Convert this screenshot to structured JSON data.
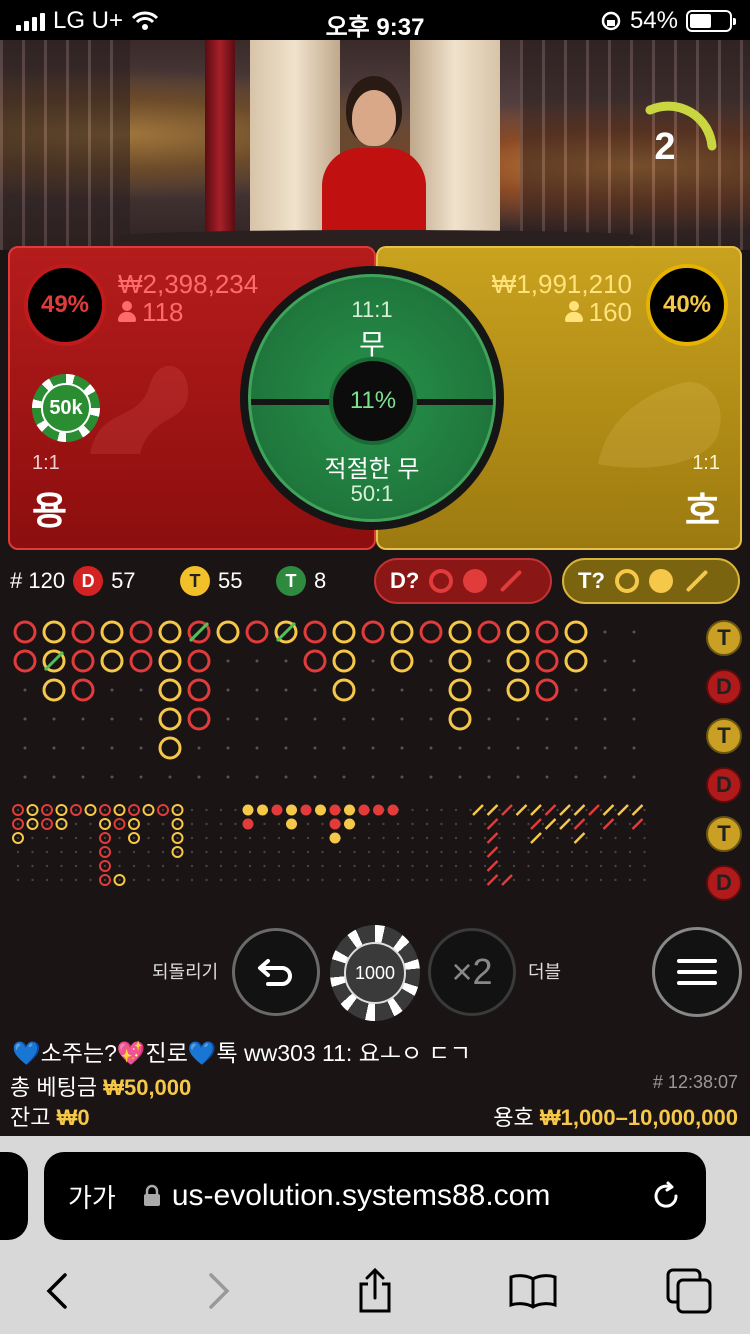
{
  "status_bar": {
    "carrier": "LG U+",
    "time": "오후 9:37",
    "battery": "54%",
    "battery_level": 0.54
  },
  "video": {
    "countdown": "2"
  },
  "dragon": {
    "percent": "49%",
    "amount": "₩2,398,234",
    "players": "118",
    "odds": "1:1",
    "name": "용"
  },
  "tiger": {
    "percent": "40%",
    "amount": "₩1,991,210",
    "players": "160",
    "odds": "1:1",
    "name": "호"
  },
  "tie": {
    "odds": "11:1",
    "name": "무",
    "percent": "11%",
    "suited_name": "적절한 무",
    "suited_odds": "50:1"
  },
  "chip_selected": "50k",
  "stats": {
    "round": "# 120",
    "dragon_badge": "D",
    "dragon": "57",
    "tiger_badge": "T",
    "tiger": "55",
    "tie_badge": "T",
    "tie": "8"
  },
  "predict": {
    "dragon": "D?",
    "tiger": "T?"
  },
  "side_predictions": [
    "T",
    "D",
    "T",
    "D",
    "T",
    "D"
  ],
  "colors": {
    "dragon": "#d42121",
    "tiger": "#f2c029",
    "tie": "#2d8a3f"
  },
  "controls": {
    "undo_label": "되돌리기",
    "chip": "1000",
    "double_symbol": "×2",
    "double_label": "더블"
  },
  "chat": {
    "message": "💙소주는?💖진로💙톡 ww303 11: 요ㅗㅇ ㄷㄱ"
  },
  "info": {
    "total_bet_label": "총 베팅금",
    "total_bet": "₩50,000",
    "game_id": "# 12:38:07",
    "balance_label": "잔고",
    "balance": "₩0",
    "limits_label": "용호",
    "limits": "₩1,000–10,000,000"
  },
  "browser": {
    "text_size": "가가",
    "url": "us-evolution.systems88.com"
  }
}
